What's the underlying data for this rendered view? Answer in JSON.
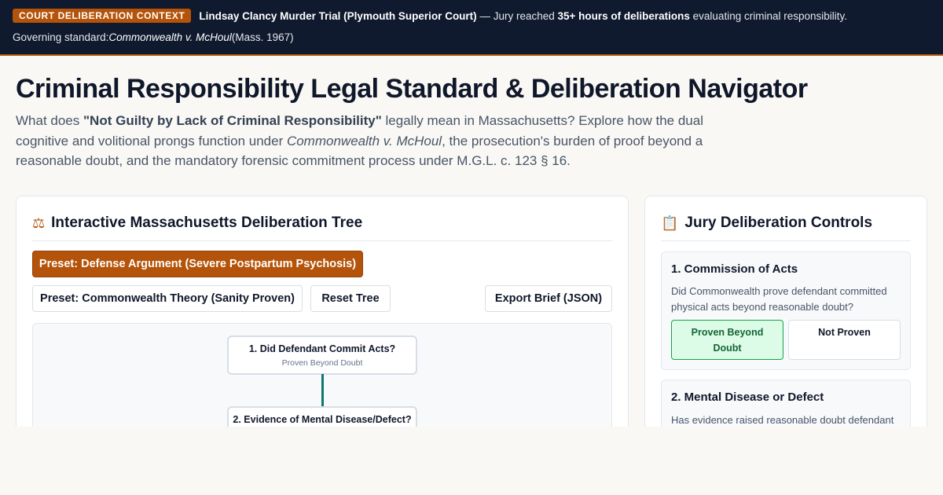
{
  "banner": {
    "badge": "COURT DELIBERATION CONTEXT",
    "trial_title": "Lindsay Clancy Murder Trial (Plymouth Superior Court)",
    "text_before_bold": " — Jury reached ",
    "hours_bold": "35+ hours of deliberations",
    "text_after_bold": " evaluating criminal responsibility.",
    "standard_label": "Governing standard: ",
    "standard_case": "Commonwealth v. McHoul",
    "standard_year": " (Mass. 1967)"
  },
  "header": {
    "title": "Criminal Responsibility Legal Standard & Deliberation Navigator",
    "intro_1": "What does ",
    "intro_bold": "\"Not Guilty by Lack of Criminal Responsibility\"",
    "intro_2": " legally mean in Massachusetts? Explore how the dual cognitive and volitional prongs function under ",
    "intro_case": "Commonwealth v. McHoul",
    "intro_3": ", the prosecution's burden of proof beyond a reasonable doubt, and the mandatory forensic commitment process under M.G.L. c. 123 § 16."
  },
  "tree_panel": {
    "icon": "scales-icon",
    "title": "Interactive Massachusetts Deliberation Tree",
    "preset_defense": "Preset: Defense Argument (Severe Postpartum Psychosis)",
    "preset_commonwealth": "Preset: Commonwealth Theory (Sanity Proven)",
    "reset": "Reset Tree",
    "export": "Export Brief (JSON)",
    "nodes": [
      {
        "title": "1. Did Defendant Commit Acts?",
        "status": "Proven Beyond Doubt"
      },
      {
        "title": "2. Evidence of Mental Disease/Defect?",
        "status": ""
      }
    ]
  },
  "controls_panel": {
    "icon": "clipboard-icon",
    "title": "Jury Deliberation Controls",
    "questions": [
      {
        "title": "1. Commission of Acts",
        "text": "Did Commonwealth prove defendant committed physical acts beyond reasonable doubt?",
        "option_yes": "Proven Beyond Doubt",
        "option_no": "Not Proven",
        "selected": "option_yes"
      },
      {
        "title": "2. Mental Disease or Defect",
        "text": "Has evidence raised reasonable doubt defendant"
      }
    ]
  },
  "colors": {
    "banner_bg": "#0f1a2e",
    "accent": "#b45309",
    "connector": "#0f766e",
    "selected_bg": "#dcfce7",
    "selected_border": "#16a34a"
  }
}
